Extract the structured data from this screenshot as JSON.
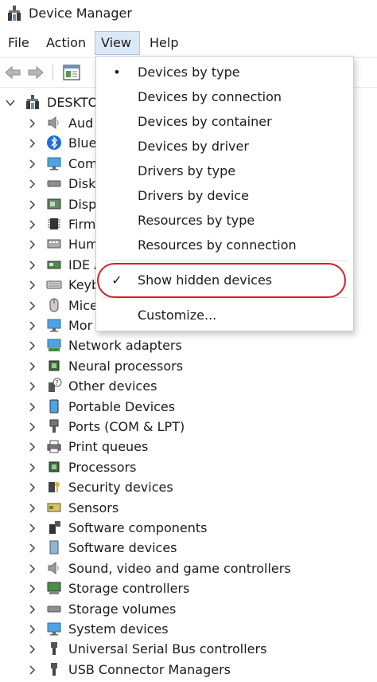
{
  "window": {
    "title": "Device Manager"
  },
  "menubar": [
    {
      "label": "File"
    },
    {
      "label": "Action"
    },
    {
      "label": "View"
    },
    {
      "label": "Help"
    }
  ],
  "tree": {
    "root": "DESKTO",
    "items": [
      {
        "label": "Aud",
        "icon": "speaker-icon"
      },
      {
        "label": "Blue",
        "icon": "bluetooth-icon"
      },
      {
        "label": "Com",
        "icon": "monitor-icon"
      },
      {
        "label": "Disk",
        "icon": "disk-drive-icon"
      },
      {
        "label": "Disp",
        "icon": "display-adapter-icon"
      },
      {
        "label": "Firm",
        "icon": "firmware-icon"
      },
      {
        "label": "Hum",
        "icon": "hid-icon"
      },
      {
        "label": "IDE A",
        "icon": "ide-controller-icon"
      },
      {
        "label": "Keyb",
        "icon": "keyboard-icon"
      },
      {
        "label": "Mice",
        "icon": "mouse-icon"
      },
      {
        "label": "Mor",
        "icon": "monitor-icon"
      },
      {
        "label": "Network adapters",
        "icon": "network-adapter-icon"
      },
      {
        "label": "Neural processors",
        "icon": "chip-icon"
      },
      {
        "label": "Other devices",
        "icon": "unknown-device-icon"
      },
      {
        "label": "Portable Devices",
        "icon": "portable-device-icon"
      },
      {
        "label": "Ports (COM & LPT)",
        "icon": "port-icon"
      },
      {
        "label": "Print queues",
        "icon": "printer-icon"
      },
      {
        "label": "Processors",
        "icon": "chip-icon"
      },
      {
        "label": "Security devices",
        "icon": "security-key-icon"
      },
      {
        "label": "Sensors",
        "icon": "sensor-icon"
      },
      {
        "label": "Software components",
        "icon": "software-component-icon"
      },
      {
        "label": "Software devices",
        "icon": "software-device-icon"
      },
      {
        "label": "Sound, video and game controllers",
        "icon": "speaker-icon"
      },
      {
        "label": "Storage controllers",
        "icon": "storage-controller-icon"
      },
      {
        "label": "Storage volumes",
        "icon": "disk-drive-icon"
      },
      {
        "label": "System devices",
        "icon": "monitor-icon"
      },
      {
        "label": "Universal Serial Bus controllers",
        "icon": "usb-icon"
      },
      {
        "label": "USB Connector Managers",
        "icon": "usb-icon"
      }
    ]
  },
  "view_menu": {
    "items": [
      {
        "label": "Devices by type",
        "mark": "•"
      },
      {
        "label": "Devices by connection",
        "mark": ""
      },
      {
        "label": "Devices by container",
        "mark": ""
      },
      {
        "label": "Devices by driver",
        "mark": ""
      },
      {
        "label": "Drivers by type",
        "mark": ""
      },
      {
        "label": "Drivers by device",
        "mark": ""
      },
      {
        "label": "Resources by type",
        "mark": ""
      },
      {
        "label": "Resources by connection",
        "mark": ""
      },
      {
        "label": "Show hidden devices",
        "mark": "✓"
      },
      {
        "label": "Customize...",
        "mark": ""
      }
    ]
  },
  "colors": {
    "highlight": "#d0202a",
    "menu_active": "#dbe8f6"
  }
}
